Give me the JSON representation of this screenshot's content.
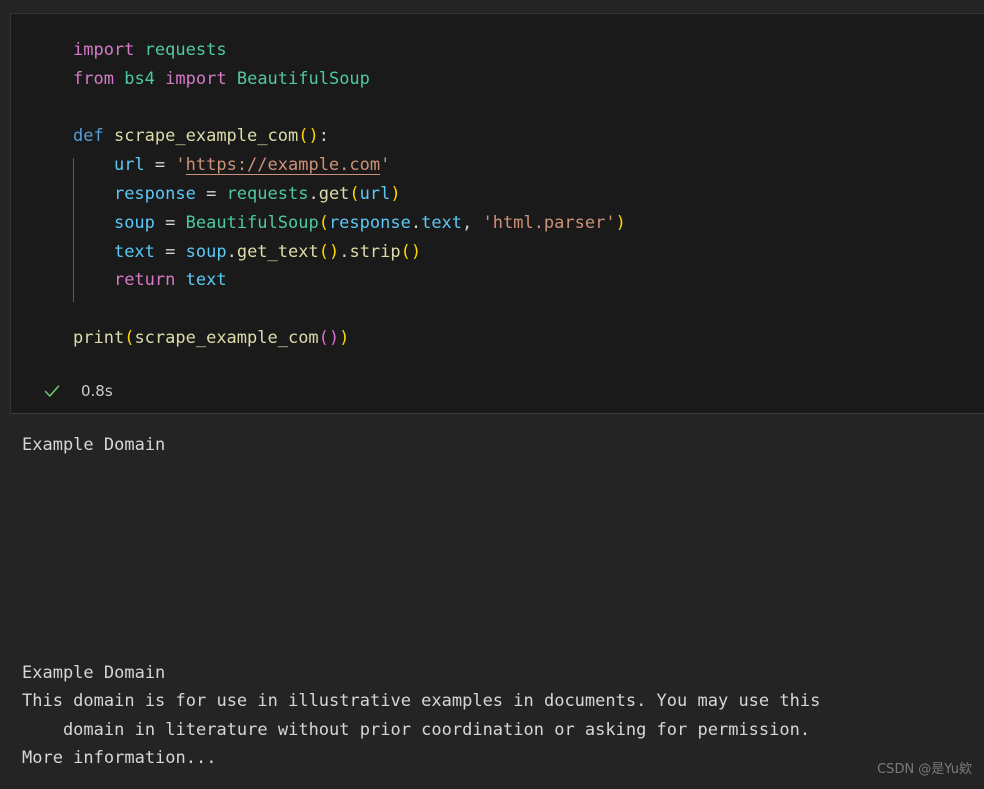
{
  "cell": {
    "code_lines": [
      [
        {
          "t": "import",
          "c": "kw"
        },
        {
          "t": " ",
          "c": "op"
        },
        {
          "t": "requests",
          "c": "mod"
        }
      ],
      [
        {
          "t": "from",
          "c": "kw"
        },
        {
          "t": " ",
          "c": "op"
        },
        {
          "t": "bs4",
          "c": "mod"
        },
        {
          "t": " ",
          "c": "op"
        },
        {
          "t": "import",
          "c": "kw"
        },
        {
          "t": " ",
          "c": "op"
        },
        {
          "t": "BeautifulSoup",
          "c": "mod"
        }
      ],
      [],
      [
        {
          "t": "def",
          "c": "kw-def"
        },
        {
          "t": " ",
          "c": "op"
        },
        {
          "t": "scrape_example_com",
          "c": "fn"
        },
        {
          "t": "()",
          "c": "punc"
        },
        {
          "t": ":",
          "c": "op"
        }
      ],
      [
        {
          "t": "    ",
          "c": "op"
        },
        {
          "t": "url",
          "c": "var"
        },
        {
          "t": " = ",
          "c": "op"
        },
        {
          "t": "'",
          "c": "str"
        },
        {
          "t": "https://example.com",
          "c": "str-link"
        },
        {
          "t": "'",
          "c": "str"
        }
      ],
      [
        {
          "t": "    ",
          "c": "op"
        },
        {
          "t": "response",
          "c": "var"
        },
        {
          "t": " = ",
          "c": "op"
        },
        {
          "t": "requests",
          "c": "mod"
        },
        {
          "t": ".",
          "c": "op"
        },
        {
          "t": "get",
          "c": "fn"
        },
        {
          "t": "(",
          "c": "punc"
        },
        {
          "t": "url",
          "c": "var"
        },
        {
          "t": ")",
          "c": "punc"
        }
      ],
      [
        {
          "t": "    ",
          "c": "op"
        },
        {
          "t": "soup",
          "c": "var"
        },
        {
          "t": " = ",
          "c": "op"
        },
        {
          "t": "BeautifulSoup",
          "c": "mod"
        },
        {
          "t": "(",
          "c": "punc"
        },
        {
          "t": "response",
          "c": "var"
        },
        {
          "t": ".",
          "c": "op"
        },
        {
          "t": "text",
          "c": "var"
        },
        {
          "t": ", ",
          "c": "op"
        },
        {
          "t": "'html.parser'",
          "c": "str"
        },
        {
          "t": ")",
          "c": "punc"
        }
      ],
      [
        {
          "t": "    ",
          "c": "op"
        },
        {
          "t": "text",
          "c": "var"
        },
        {
          "t": " = ",
          "c": "op"
        },
        {
          "t": "soup",
          "c": "var"
        },
        {
          "t": ".",
          "c": "op"
        },
        {
          "t": "get_text",
          "c": "fn"
        },
        {
          "t": "()",
          "c": "punc"
        },
        {
          "t": ".",
          "c": "op"
        },
        {
          "t": "strip",
          "c": "fn"
        },
        {
          "t": "()",
          "c": "punc"
        }
      ],
      [
        {
          "t": "    ",
          "c": "op"
        },
        {
          "t": "return",
          "c": "kw"
        },
        {
          "t": " ",
          "c": "op"
        },
        {
          "t": "text",
          "c": "var"
        }
      ],
      [],
      [
        {
          "t": "print",
          "c": "fn"
        },
        {
          "t": "(",
          "c": "punc"
        },
        {
          "t": "scrape_example_com",
          "c": "fn"
        },
        {
          "t": "()",
          "c": "punc2"
        },
        {
          "t": ")",
          "c": "punc"
        }
      ]
    ],
    "code_plain": [
      "import requests",
      "from bs4 import BeautifulSoup",
      "",
      "def scrape_example_com():",
      "    url = 'https://example.com'",
      "    response = requests.get(url)",
      "    soup = BeautifulSoup(response.text, 'html.parser')",
      "    text = soup.get_text().strip()",
      "    return text",
      "",
      "print(scrape_example_com())"
    ],
    "status": {
      "icon": "check-icon",
      "icon_color": "#6cc16c",
      "time": "0.8s"
    }
  },
  "output": {
    "title": "Example Domain",
    "body": [
      "Example Domain",
      "This domain is for use in illustrative examples in documents. You may use this",
      "    domain in literature without prior coordination or asking for permission.",
      "More information..."
    ]
  },
  "watermark": {
    "text": "CSDN @是Yu欸"
  },
  "colors": {
    "cell_bg": "#1a1a1a",
    "page_bg": "#242424",
    "keyword": "#d679c8",
    "def_keyword": "#569cd6",
    "module": "#4ec9a0",
    "function": "#dcdcaa",
    "variable": "#5cc8f5",
    "bracket1": "#ffd700",
    "bracket2": "#da70d6",
    "string": "#ce9178",
    "output_text": "#d6d6d6",
    "status_check": "#6cc16c"
  }
}
